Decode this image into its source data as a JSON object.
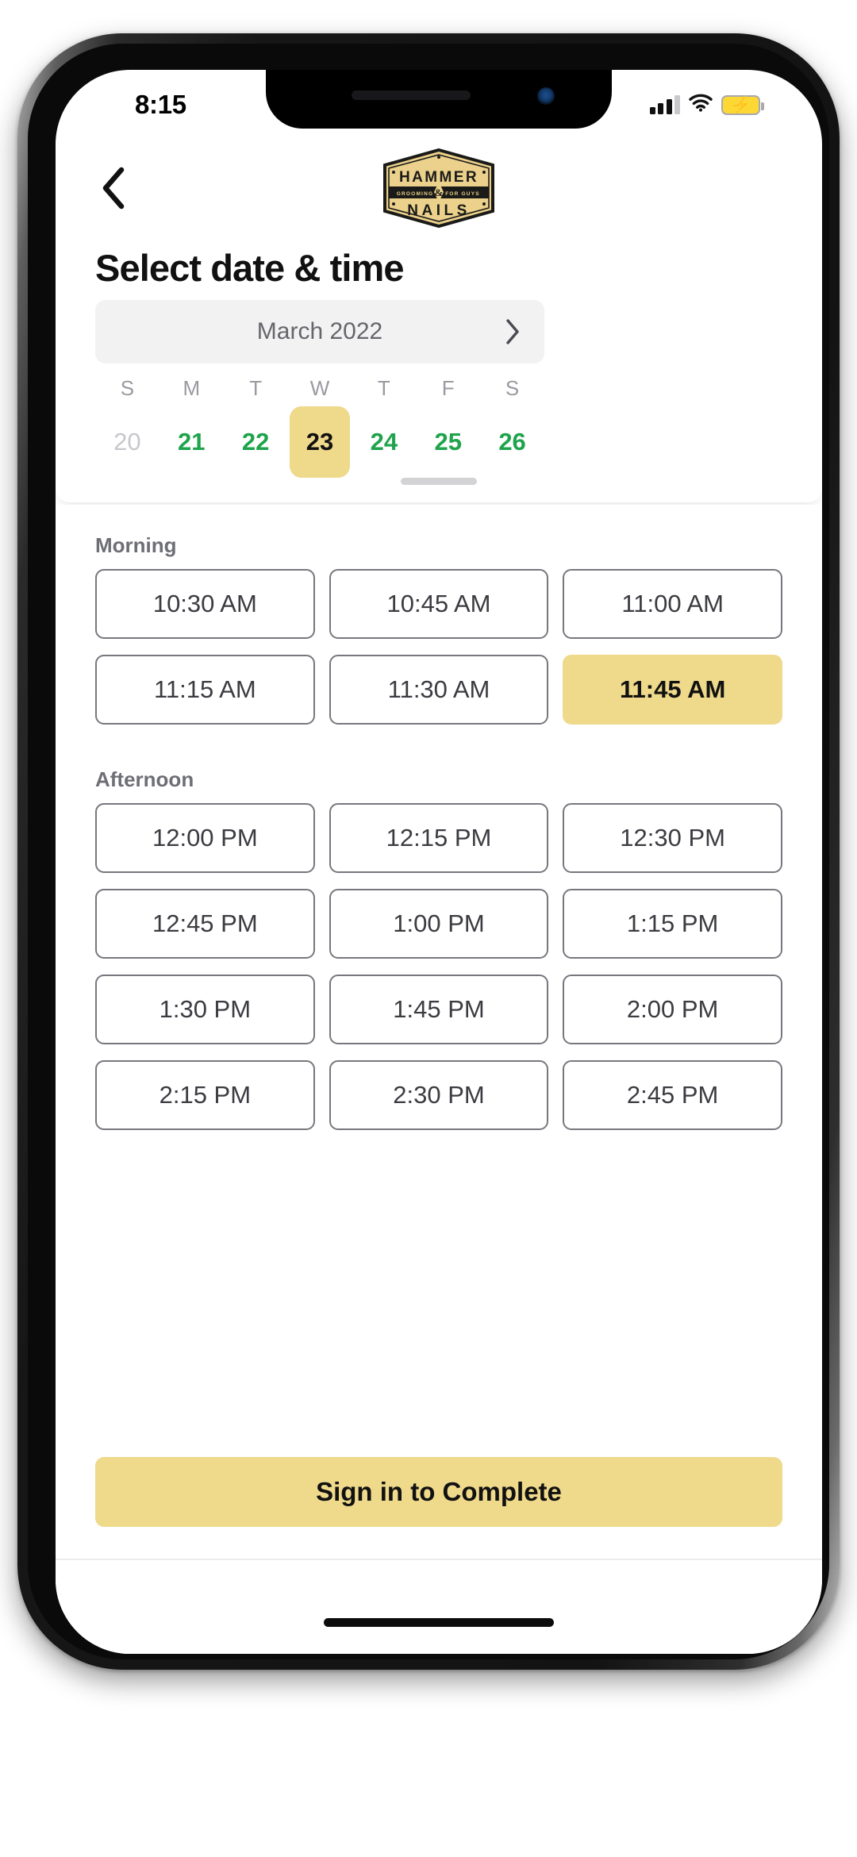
{
  "status_bar": {
    "time": "8:15",
    "signal_icon": "cellular-signal-icon",
    "wifi_icon": "wifi-icon",
    "battery_icon": "battery-charging-icon",
    "battery_bolt": "⚡",
    "battery_color": "#fdd835"
  },
  "header": {
    "back_icon": "chevron-left-icon",
    "logo": {
      "name": "hammer-and-nails-logo",
      "top_text": "HAMMER",
      "band_left_text": "GROOMING",
      "band_center_text": "&",
      "band_right_text": "FOR GUYS",
      "bottom_text": "NAILS",
      "gold": "#EBD18B",
      "ink": "#1A1A18"
    }
  },
  "page": {
    "title": "Select date & time"
  },
  "calendar": {
    "month_label": "March 2022",
    "next_icon": "chevron-right-icon",
    "weekdays": [
      "S",
      "M",
      "T",
      "W",
      "T",
      "F",
      "S"
    ],
    "dates": [
      {
        "day": "20",
        "state": "disabled"
      },
      {
        "day": "21",
        "state": "available"
      },
      {
        "day": "22",
        "state": "available"
      },
      {
        "day": "23",
        "state": "selected"
      },
      {
        "day": "24",
        "state": "available"
      },
      {
        "day": "25",
        "state": "available"
      },
      {
        "day": "26",
        "state": "available"
      }
    ],
    "available_color": "#1FA34C",
    "disabled_color": "#C7C7CC",
    "selected_bg": "#EFD98B",
    "drag_handle": "calendar-drag-handle"
  },
  "slots": {
    "morning": {
      "label": "Morning",
      "times": [
        {
          "time": "10:30 AM",
          "state": "available"
        },
        {
          "time": "10:45 AM",
          "state": "available"
        },
        {
          "time": "11:00 AM",
          "state": "available"
        },
        {
          "time": "11:15 AM",
          "state": "available"
        },
        {
          "time": "11:30 AM",
          "state": "available"
        },
        {
          "time": "11:45 AM",
          "state": "selected"
        }
      ]
    },
    "afternoon": {
      "label": "Afternoon",
      "times": [
        {
          "time": "12:00 PM",
          "state": "available"
        },
        {
          "time": "12:15 PM",
          "state": "available"
        },
        {
          "time": "12:30 PM",
          "state": "available"
        },
        {
          "time": "12:45 PM",
          "state": "available"
        },
        {
          "time": "1:00 PM",
          "state": "available"
        },
        {
          "time": "1:15 PM",
          "state": "available"
        },
        {
          "time": "1:30 PM",
          "state": "available"
        },
        {
          "time": "1:45 PM",
          "state": "available"
        },
        {
          "time": "2:00 PM",
          "state": "available"
        },
        {
          "time": "2:15 PM",
          "state": "available"
        },
        {
          "time": "2:30 PM",
          "state": "available"
        },
        {
          "time": "2:45 PM",
          "state": "available"
        }
      ]
    }
  },
  "cta": {
    "label": "Sign in to Complete",
    "background": "#EFD98B"
  }
}
